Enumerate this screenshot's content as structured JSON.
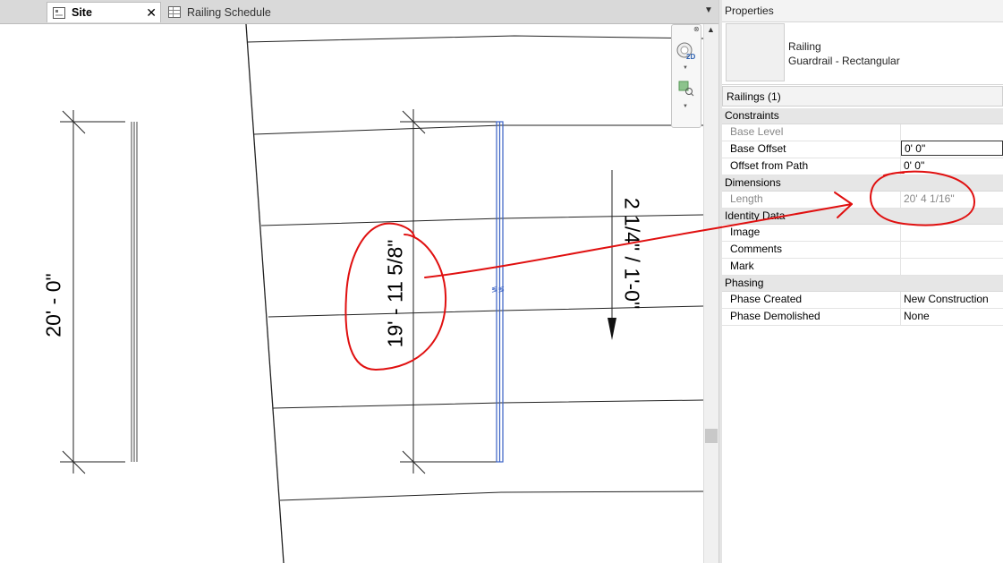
{
  "tabs": [
    {
      "label": "Site",
      "active": true
    },
    {
      "label": "Railing Schedule",
      "active": false
    }
  ],
  "tab_close": "✕",
  "tab_menu": "▼",
  "canvas": {
    "dimension_left": "20' - 0\"",
    "dimension_mid": "19' - 11 5/8\"",
    "slope_label": "2 1/4\" / 1'-0\"",
    "railing_tag": "≶≶"
  },
  "nav": {
    "wheel_label": "2D"
  },
  "scroll_up": "▲",
  "properties": {
    "title": "Properties",
    "family": "Railing",
    "type": "Guardrail - Rectangular",
    "selection": "Railings (1)",
    "groups": [
      {
        "name": "Constraints",
        "rows": [
          {
            "key": "Base Level",
            "value": "",
            "disabled": true
          },
          {
            "key": "Base Offset",
            "value": "0'  0\"",
            "editing": true
          },
          {
            "key": "Offset from Path",
            "value": "0'  0\""
          }
        ]
      },
      {
        "name": "Dimensions",
        "rows": [
          {
            "key": "Length",
            "value": "20'  4 1/16\"",
            "disabled": true
          }
        ]
      },
      {
        "name": "Identity Data",
        "rows": [
          {
            "key": "Image",
            "value": ""
          },
          {
            "key": "Comments",
            "value": ""
          },
          {
            "key": "Mark",
            "value": ""
          }
        ]
      },
      {
        "name": "Phasing",
        "rows": [
          {
            "key": "Phase Created",
            "value": "New Construction"
          },
          {
            "key": "Phase Demolished",
            "value": "None"
          }
        ]
      }
    ]
  },
  "colors": {
    "annotation": "#e01010",
    "selection": "#3a62c4"
  }
}
